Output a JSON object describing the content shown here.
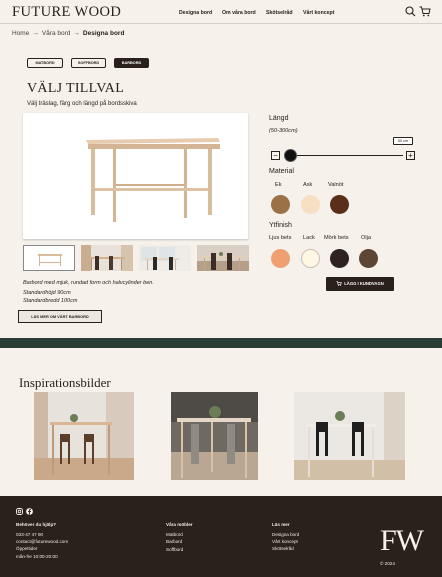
{
  "header": {
    "logo": "FUTURE WOOD",
    "nav": [
      "Designa bord",
      "Om våra bord",
      "Skötselråd",
      "Vårt koncept"
    ],
    "icons": [
      "search-icon",
      "cart-icon"
    ]
  },
  "breadcrumb": {
    "home": "Home",
    "level2": "Våra bord",
    "current": "Designa bord",
    "separator": "→"
  },
  "type_pills": [
    {
      "label": "MATBORD",
      "active": false
    },
    {
      "label": "SOFFBORD",
      "active": false
    },
    {
      "label": "BARBORD",
      "active": true
    }
  ],
  "configurator": {
    "title": "VÄLJ TILLVAL",
    "subtitle": "Välj träslag, färg och längd på bordsskiva",
    "length_label": "Längd",
    "length_range": "(50-300cm)",
    "length_value": "50 cm",
    "minus": "−",
    "plus": "+",
    "material_label": "Material",
    "materials": [
      {
        "name": "Ek",
        "color": "#9b7147"
      },
      {
        "name": "Ask",
        "color": "#f7dfc4"
      },
      {
        "name": "Valnöt",
        "color": "#5a2e18"
      }
    ],
    "finish_label": "Ytfinish",
    "finishes": [
      {
        "name": "Ljus bets",
        "color": "#f0a070"
      },
      {
        "name": "Lack",
        "color": "#fdf7e4"
      },
      {
        "name": "Mörk bets",
        "color": "#2e2320"
      },
      {
        "name": "Olja",
        "color": "#5e4636"
      }
    ],
    "cart_button": "LÄGG I KUNDVAGN",
    "cart_icon": "cart-icon"
  },
  "product": {
    "description": [
      "Barbord med mjuk, rundad form och halvcylinder ben.",
      "Standardhöjd 90cm",
      "Standardbredd 100cm"
    ],
    "more_button": "LÄS MER OM VÅRT BARBORD"
  },
  "inspiration": {
    "title": "Inspirationsbilder"
  },
  "footer": {
    "social_icons": [
      "instagram-icon",
      "facebook-icon"
    ],
    "help": {
      "title": "Behöver du hjälp?",
      "phone": "033-47 47 90",
      "email": "contact@futurewood.com",
      "hours_label": "Öppettider",
      "hours": "mån-fre 10:00-20:00"
    },
    "products": {
      "title": "Våra möbler",
      "items": [
        "Matbord",
        "Barbord",
        "Soffbord"
      ]
    },
    "learn": {
      "title": "Läs mer",
      "items": [
        "Designa bord",
        "Vårt koncept",
        "Skötselråd"
      ]
    },
    "brand_mark": "FW",
    "copyright": "© 2024"
  }
}
